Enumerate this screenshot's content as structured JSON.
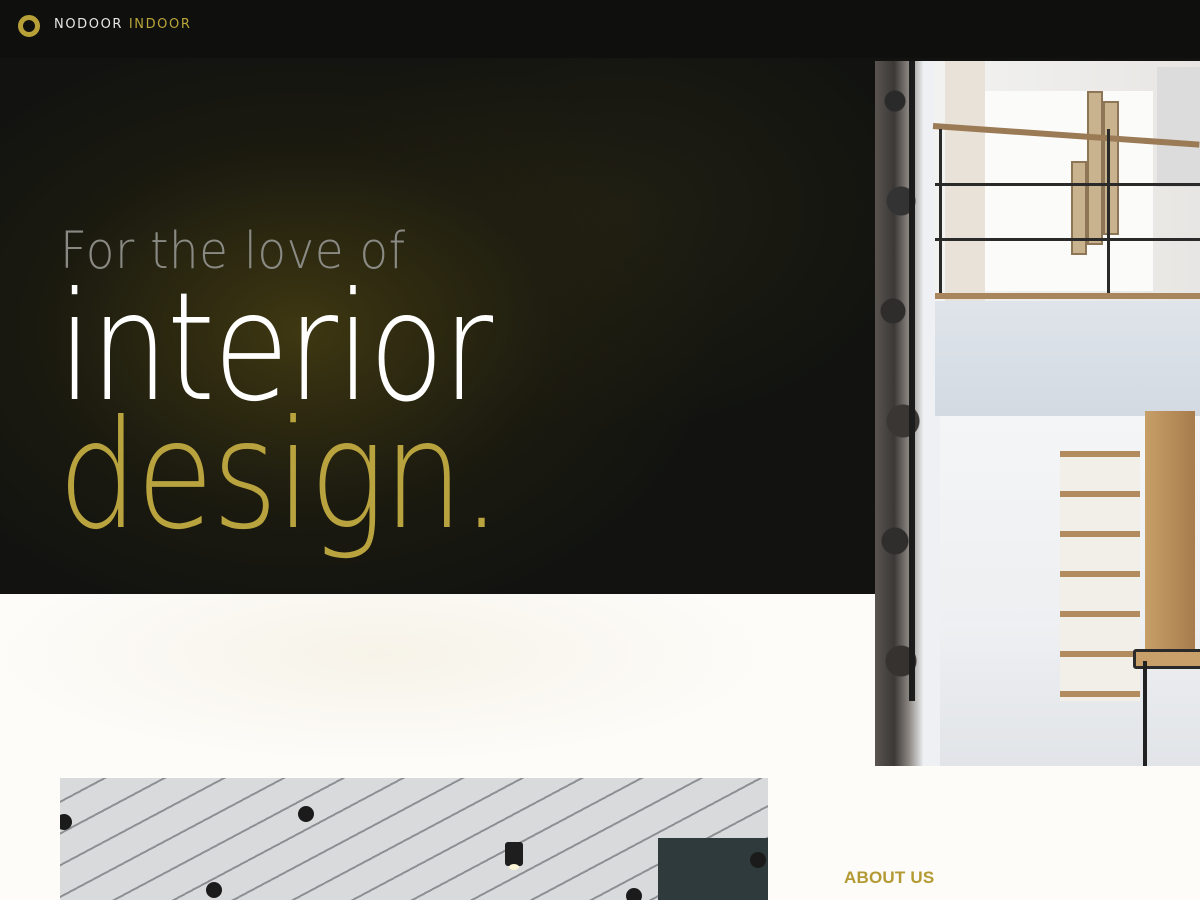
{
  "header": {
    "brand_primary": "NODOOR",
    "brand_accent": "INDOOR"
  },
  "hero": {
    "tagline": "For the love of",
    "headline_line1": "interior",
    "headline_line2": "design."
  },
  "about": {
    "heading": "ABOUT US"
  },
  "colors": {
    "accent": "#b8a33e",
    "dark_background": "#121310",
    "light_background": "#fdfcf9"
  },
  "images": {
    "right_photo": "interior-staircase-photo",
    "bottom_photo": "ceiling-lights-photo"
  }
}
